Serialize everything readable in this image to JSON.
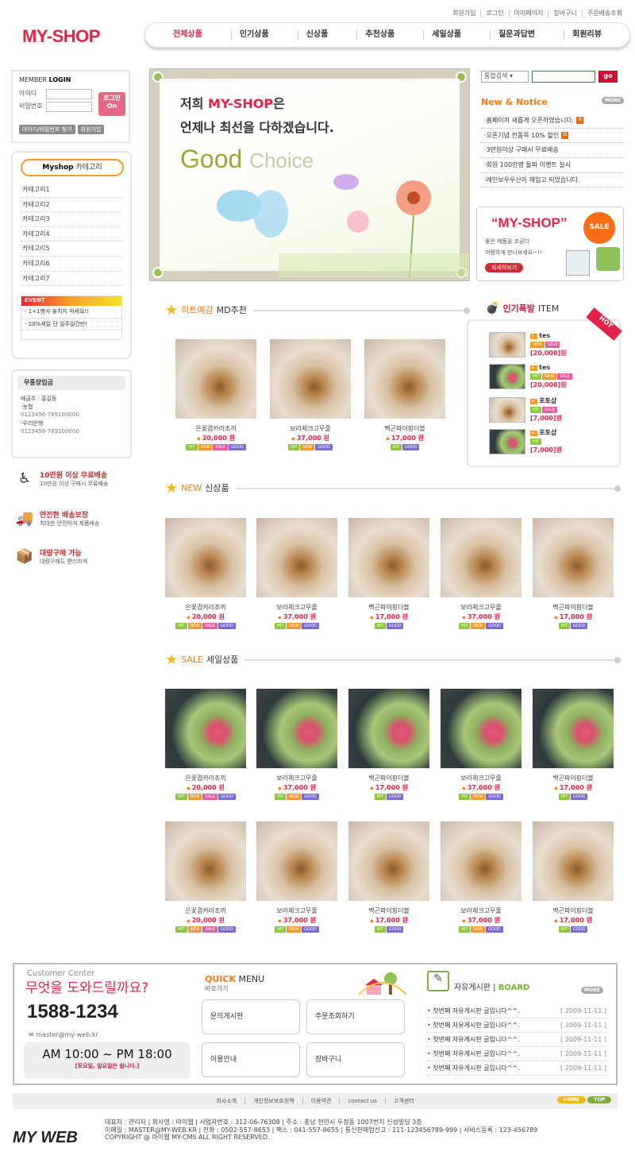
{
  "util_links": [
    "회원가입",
    "로그인",
    "마이페이지",
    "장바구니",
    "주문배송조회"
  ],
  "logo": "MY-SHOP",
  "gnb": [
    "전체상품",
    "인기상품",
    "신상품",
    "추천상품",
    "세일상품",
    "질문과답변",
    "회원리뷰"
  ],
  "login": {
    "title_a": "MEMBER",
    "title_b": "LOGIN",
    "id_label": "아이디",
    "pw_label": "비밀번호",
    "login_btn": "로그인",
    "btn_find": "아이디/비밀번호 찾기",
    "btn_join": "회원가입"
  },
  "category": {
    "head_a": "Myshop",
    "head_b": "카테고리",
    "items": [
      "카테고리1",
      "카테고리2",
      "카테고리3",
      "카테고리4",
      "카테고리5",
      "카테고리6",
      "카테고리7"
    ],
    "event_label": "EVENT",
    "events": [
      "1+1행사 놓치지 마세요!!",
      "20%세일 단 일주일간만!"
    ]
  },
  "bank": {
    "title": "무통장입금",
    "holder": "예금주 : 홍길동",
    "banks": [
      {
        "name": "-농협",
        "num": "0123456-789100000"
      },
      {
        "name": "-우리은행",
        "num": "0123456-789100000"
      }
    ]
  },
  "services": [
    {
      "icon": "delivery-icon",
      "t1": "10만원 이상 무료배송",
      "t2": "10만원 이상 구매시 무료배송"
    },
    {
      "icon": "safe-delivery-icon",
      "t1": "안전한 배송보장",
      "t2": "최대한 안전하게 제품배송"
    },
    {
      "icon": "bulk-buy-icon",
      "t1": "대량구매 가능",
      "t2": "대량구매도 편리하게"
    }
  ],
  "banner": {
    "l1a": "저희",
    "l1b": "MY-SHOP",
    "l1c": "은",
    "l2": "언제나  최선을 다하겠습니다.",
    "g1": "Good",
    "g2": "Choice"
  },
  "search": {
    "select": "통합검색",
    "go": "go"
  },
  "notice": {
    "title": "New & Notice",
    "more": "MORE",
    "items": [
      "홈페이지 새롭게 오픈하였습니다.",
      "오픈기념 전품목 10% 할인",
      "3만원이상 구매시 무료배송",
      "회원 100만명 돌파 이벤트 실시",
      "레인보우우산이 재입고 되었습니다."
    ],
    "new_flags": [
      true,
      true,
      false,
      false,
      false
    ]
  },
  "shopbanner": {
    "title": "“MY-SHOP”",
    "desc1": "좋은 제품을 조금더",
    "desc2": "저렴하게 만나보세요~!!",
    "btn": "자세히보기",
    "sale": "SALE"
  },
  "sections": {
    "md": {
      "a": "히트예감",
      "b": "MD추천"
    },
    "new": {
      "a": "NEW",
      "b": "신상품"
    },
    "sale": {
      "a": "SALE",
      "b": "세일상품"
    }
  },
  "md_products": [
    {
      "name": "은꽃겹카라조끼",
      "price": "20,000 원",
      "badges": [
        "HIT",
        "NEW",
        "SALE",
        "GOOD"
      ]
    },
    {
      "name": "보라체크고무줄",
      "price": "37,000 원",
      "badges": [
        "HIT",
        "NEW",
        "GOOD"
      ]
    },
    {
      "name": "백곤파이핑더블",
      "price": "17,000 원",
      "badges": [
        "HIT",
        "GOOD"
      ]
    }
  ],
  "new_products": [
    {
      "name": "은꽃겹카라조끼",
      "price": "20,000 원",
      "badges": [
        "HIT",
        "NEW",
        "SALE",
        "GOOD"
      ]
    },
    {
      "name": "보라체크고무줄",
      "price": "37,000 원",
      "badges": [
        "HIT",
        "NEW",
        "GOOD"
      ]
    },
    {
      "name": "백곤파이핑더블",
      "price": "17,000 원",
      "badges": [
        "HIT",
        "GOOD"
      ]
    },
    {
      "name": "보라체크고무줄",
      "price": "37,000 원",
      "badges": [
        "HIT",
        "NEW",
        "GOOD"
      ]
    },
    {
      "name": "백곤파이핑더블",
      "price": "17,000 원",
      "badges": [
        "HIT",
        "GOOD"
      ]
    }
  ],
  "sale_products_1": [
    {
      "name": "은꽃겹카라조끼",
      "price": "20,000 원",
      "badges": [
        "HIT",
        "NEW",
        "SALE",
        "GOOD"
      ]
    },
    {
      "name": "보라체크고무줄",
      "price": "37,000 원",
      "badges": [
        "HIT",
        "NEW",
        "GOOD"
      ]
    },
    {
      "name": "백곤파이핑더블",
      "price": "17,000 원",
      "badges": [
        "HIT",
        "GOOD"
      ]
    },
    {
      "name": "보라체크고무줄",
      "price": "37,000 원",
      "badges": [
        "HIT",
        "NEW",
        "GOOD"
      ]
    },
    {
      "name": "백곤파이핑더블",
      "price": "17,000 원",
      "badges": [
        "HIT",
        "GOOD"
      ]
    }
  ],
  "sale_products_2": [
    {
      "name": "은꽃겹카라조끼",
      "price": "20,000 원",
      "badges": [
        "HIT",
        "NEW",
        "SALE",
        "GOOD"
      ]
    },
    {
      "name": "보라체크고무줄",
      "price": "37,000 원",
      "badges": [
        "HIT",
        "NEW",
        "GOOD"
      ]
    },
    {
      "name": "백곤파이핑더블",
      "price": "17,000 원",
      "badges": [
        "HIT",
        "GOOD"
      ]
    },
    {
      "name": "보라체크고무줄",
      "price": "37,000 원",
      "badges": [
        "HIT",
        "NEW",
        "GOOD"
      ]
    },
    {
      "name": "백곤파이핑더블",
      "price": "17,000 원",
      "badges": [
        "HIT",
        "GOOD"
      ]
    }
  ],
  "hot": {
    "title_a": "인기폭발",
    "title_b": "ITEM",
    "ribbon": "HOT",
    "items": [
      {
        "name": "tes",
        "price": "[20,000]원",
        "badges": [
          "NEW",
          "SALE"
        ]
      },
      {
        "name": "tes",
        "price": "[20,000]원",
        "badges": [
          "HIT",
          "NEW",
          "SALE"
        ]
      },
      {
        "name": "포토샵",
        "price": "[7,000]원",
        "badges": [
          "HIT",
          "SALE"
        ]
      },
      {
        "name": "포토샵",
        "price": "[7,000]원",
        "badges": [
          "HIT"
        ]
      }
    ]
  },
  "customer": {
    "title": "Customer Center",
    "question": "무엇을 도와드릴까요?",
    "tel": "1588-1234",
    "mail": "master@my-web.kr",
    "hours": "AM 10:00 ~ PM 18:00",
    "closed": "[토요일, 일요일은 쉽니다.]"
  },
  "quick": {
    "title_a": "QUICK",
    "title_b": "MENU",
    "sub": "바로가기",
    "buttons": [
      "문의게시판",
      "주문조회하기",
      "이용안내",
      "장바구니"
    ]
  },
  "board": {
    "title_a": "자유게시판",
    "title_b": "BOARD",
    "more": "MORE",
    "items": [
      {
        "t": "첫번째 자유게시판 글입니다^^.",
        "d": "[ 2009-11-11 ]"
      },
      {
        "t": "첫번째 자유게시판 글입니다^^.",
        "d": "[ 2009-11-11 ]"
      },
      {
        "t": "첫번째 자유게시판 글입니다^^.",
        "d": "[ 2009-11-11 ]"
      },
      {
        "t": "첫번째 자유게시판 글입니다^^.",
        "d": "[ 2009-11-11 ]"
      },
      {
        "t": "첫번째 자유게시판 글입니다^^.",
        "d": "[ 2009-11-11 ]"
      }
    ]
  },
  "footer_nav": [
    "회사소개",
    "개인정보보호정책",
    "이용약관",
    "contact us",
    "고객센터"
  ],
  "footer_btns": {
    "home": "HOME",
    "top": "TOP"
  },
  "footer_logo": "MY WEB",
  "footer_info": [
    "대표자 : 관리자  |  회사명 : 마이웹  |  사업자번호 : 312-06-76308  |  주소 : 충남 천안시 두정동 1007번지 신성빌딩 3층",
    "이메일 : MASTER@MY-WEB.KR  |  전화 : 0502-557-8653  |  팩스 : 041-557-8655  |  통신판매업신고 : 111-123456789-999  |  서비스등록 : 123-456789",
    "COPYRIGHT @ 마이웹 MY-CMS ALL RIGHT RESERVED."
  ]
}
